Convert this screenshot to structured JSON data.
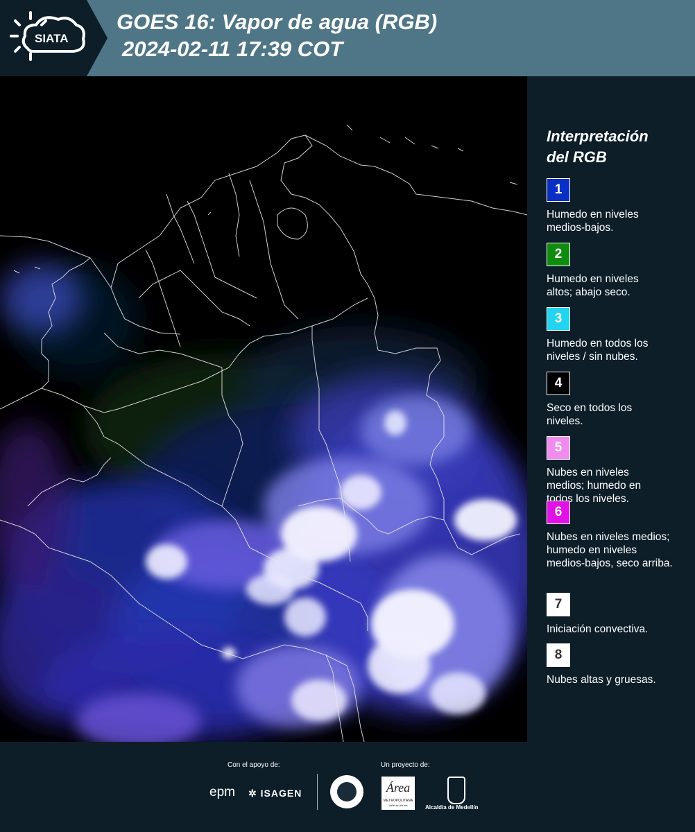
{
  "header": {
    "logo_text": "SIATA",
    "title_line1": "GOES 16: Vapor de agua (RGB)",
    "title_line2": "2024-02-11 17:39 COT"
  },
  "legend": {
    "title_line1": "Interpretación",
    "title_line2": "del RGB",
    "items": [
      {
        "number": "1",
        "color": "#0a2fc4",
        "text_color": "#ffffff",
        "line1": "Humedo en niveles",
        "line2": "medios-bajos.",
        "line3": ""
      },
      {
        "number": "2",
        "color": "#0f8c0f",
        "text_color": "#ffffff",
        "line1": "Humedo en niveles",
        "line2": "altos; abajo seco.",
        "line3": ""
      },
      {
        "number": "3",
        "color": "#22d4ee",
        "text_color": "#ffffff",
        "line1": "Humedo en todos los",
        "line2": "niveles / sin nubes.",
        "line3": ""
      },
      {
        "number": "4",
        "color": "#000000",
        "text_color": "#ffffff",
        "line1": "Seco en todos los",
        "line2": "niveles.",
        "line3": ""
      },
      {
        "number": "5",
        "color": "#f08cee",
        "text_color": "#ffffff",
        "line1": "Nubes en niveles",
        "line2": "medios; humedo en",
        "line3": "todos los niveles."
      },
      {
        "number": "6",
        "color": "#e012e6",
        "text_color": "#ffffff",
        "line1": "Nubes en niveles medios;",
        "line2": "humedo en niveles",
        "line3": "medios-bajos, seco arriba."
      },
      {
        "number": "7",
        "color": "#ffffff",
        "text_color": "#333333",
        "line1": "Iniciación convectiva.",
        "line2": "",
        "line3": ""
      },
      {
        "number": "8",
        "color": "#ffffff",
        "text_color": "#333333",
        "line1": "Nubes altas y gruesas.",
        "line2": "",
        "line3": ""
      }
    ]
  },
  "footer": {
    "support_label": "Con el apoyo de:",
    "project_label": "Un proyecto de:",
    "sponsor1": "epm",
    "sponsor2": "ISAGEN",
    "partner1": "METROPOLITANA",
    "partner1_sub": "Valle de Aburrá",
    "partner1_script": "Área",
    "partner2": "Alcaldía de Medellín"
  }
}
